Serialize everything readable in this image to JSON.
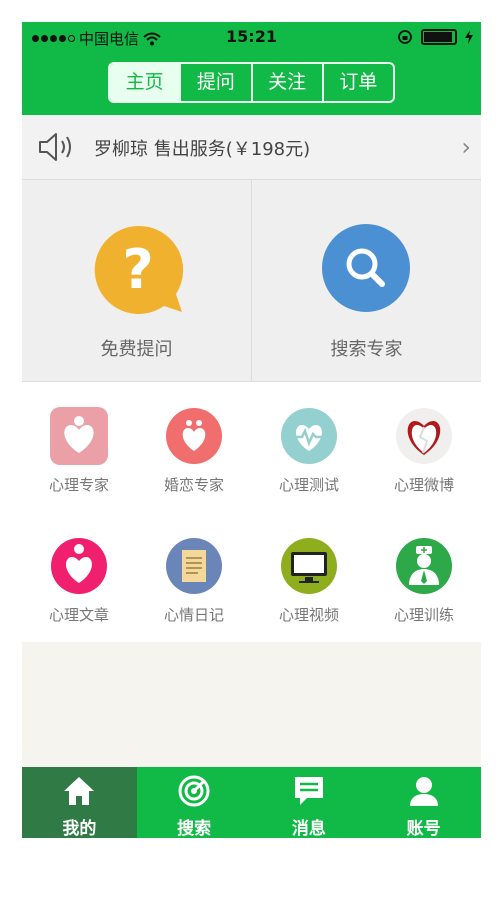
{
  "status_bar": {
    "carrier": "中国电信",
    "time": "15:21"
  },
  "top_tabs": [
    {
      "label": "主页"
    },
    {
      "label": "提问"
    },
    {
      "label": "关注"
    },
    {
      "label": "订单"
    }
  ],
  "notice": {
    "icon": "speaker-icon",
    "text": "罗柳琼 售出服务(￥198元)"
  },
  "big_actions": [
    {
      "label": "免费提问",
      "icon": "question-bubble-icon",
      "color": "#f0b22e"
    },
    {
      "label": "搜索专家",
      "icon": "search-icon",
      "color": "#4a90d2"
    }
  ],
  "grid_row1": [
    {
      "label": "心理专家",
      "icon": "heart-person-icon",
      "color": "#eaa0a6"
    },
    {
      "label": "婚恋专家",
      "icon": "couple-icon",
      "color": "#f06e6e"
    },
    {
      "label": "心理测试",
      "icon": "heartbeat-icon",
      "color": "#93d0cf"
    },
    {
      "label": "心理微博",
      "icon": "broken-heart-icon",
      "color": "#f1eeee"
    }
  ],
  "grid_row2": [
    {
      "label": "心理文章",
      "icon": "heart-drop-icon",
      "color": "#f0206e"
    },
    {
      "label": "心情日记",
      "icon": "notebook-icon",
      "color": "#6a86b8"
    },
    {
      "label": "心理视频",
      "icon": "monitor-icon",
      "color": "#8fae1e"
    },
    {
      "label": "心理训练",
      "icon": "nurse-icon",
      "color": "#2ea94a"
    }
  ],
  "tabbar": [
    {
      "label": "我的",
      "icon": "home-icon"
    },
    {
      "label": "搜索",
      "icon": "radar-icon"
    },
    {
      "label": "消息",
      "icon": "message-icon"
    },
    {
      "label": "账号",
      "icon": "user-icon"
    }
  ],
  "colors": {
    "brand_green": "#11b946",
    "active_tab_bg": "#2f7a45"
  }
}
